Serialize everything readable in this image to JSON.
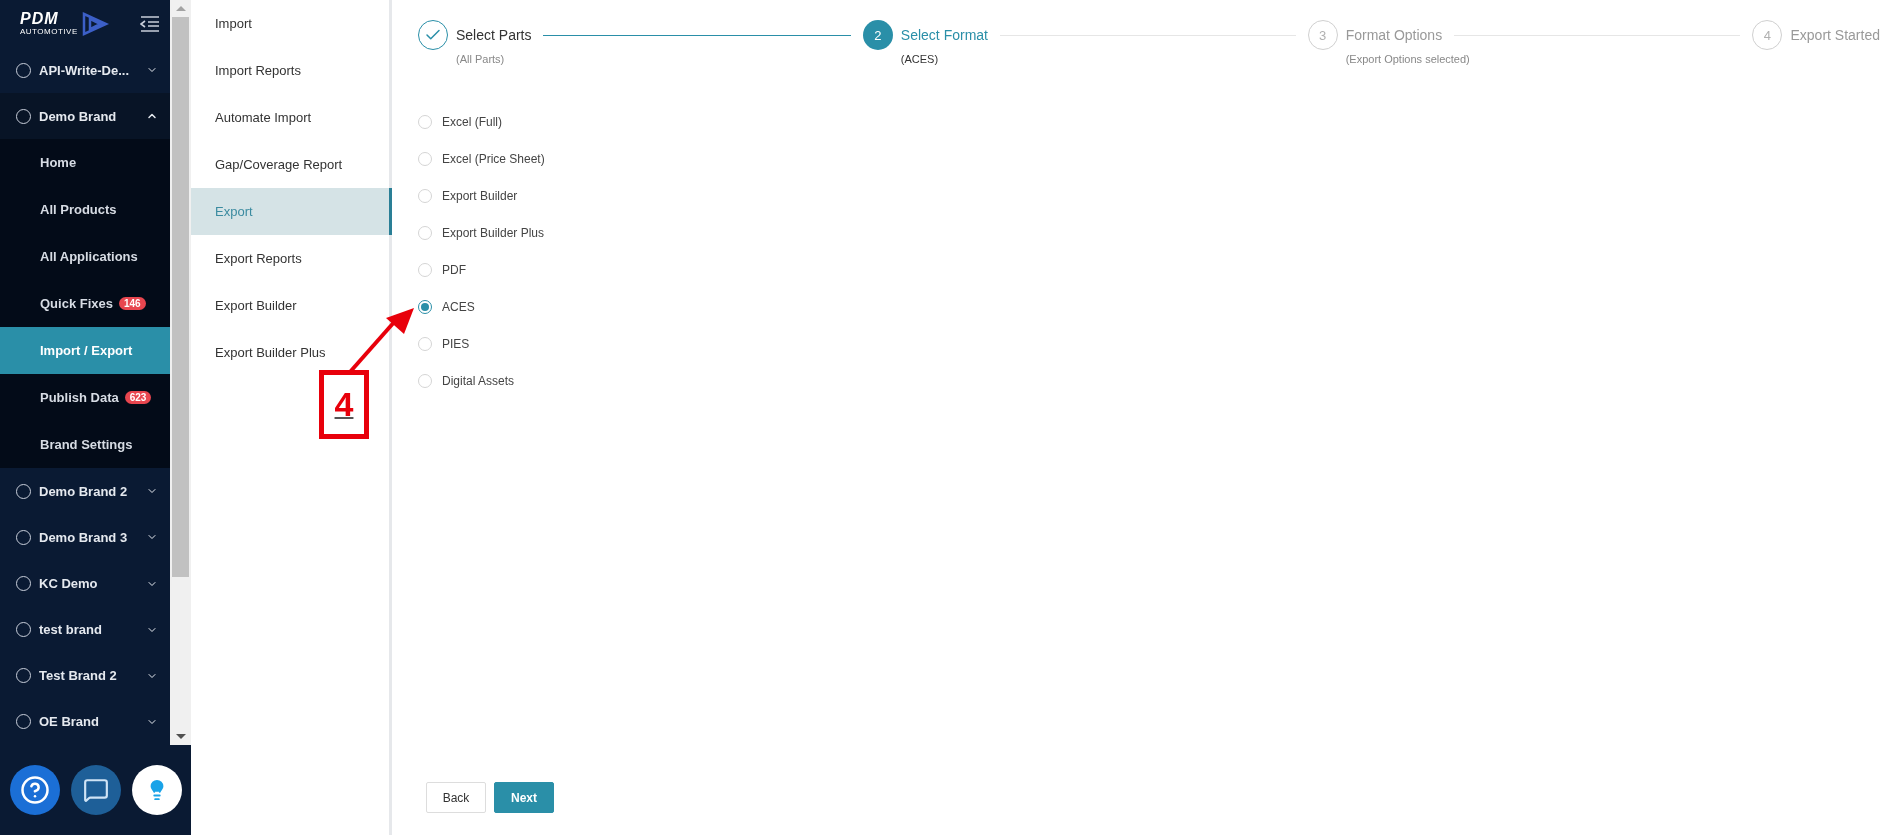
{
  "logo": {
    "name": "PDM",
    "tagline": "AUTOMOTIVE"
  },
  "sidebar": {
    "items": [
      {
        "label": "API-Write-De...",
        "expanded": false
      },
      {
        "label": "Demo Brand",
        "expanded": true,
        "children": [
          {
            "label": "Home",
            "selected": false
          },
          {
            "label": "All Products",
            "selected": false
          },
          {
            "label": "All Applications",
            "selected": false
          },
          {
            "label": "Quick Fixes",
            "badge": "146",
            "selected": false
          },
          {
            "label": "Import / Export",
            "selected": true
          },
          {
            "label": "Publish Data",
            "badge": "623",
            "selected": false
          },
          {
            "label": "Brand Settings",
            "selected": false
          }
        ]
      },
      {
        "label": "Demo Brand 2",
        "expanded": false
      },
      {
        "label": "Demo Brand 3",
        "expanded": false
      },
      {
        "label": "KC Demo",
        "expanded": false
      },
      {
        "label": "test brand",
        "expanded": false
      },
      {
        "label": "Test Brand 2",
        "expanded": false
      },
      {
        "label": "OE Brand",
        "expanded": false
      }
    ]
  },
  "subnav": {
    "items": [
      {
        "label": "Import",
        "selected": false
      },
      {
        "label": "Import Reports",
        "selected": false
      },
      {
        "label": "Automate Import",
        "selected": false
      },
      {
        "label": "Gap/Coverage Report",
        "selected": false
      },
      {
        "label": "Export",
        "selected": true
      },
      {
        "label": "Export Reports",
        "selected": false
      },
      {
        "label": "Export Builder",
        "selected": false
      },
      {
        "label": "Export Builder Plus",
        "selected": false
      }
    ]
  },
  "steps": [
    {
      "kind": "done",
      "title": "Select Parts",
      "subtitle": "(All Parts)"
    },
    {
      "kind": "active",
      "number": "2",
      "title": "Select Format",
      "subtitle": "(ACES)"
    },
    {
      "kind": "pending",
      "number": "3",
      "title": "Format Options",
      "subtitle": "(Export Options selected)"
    },
    {
      "kind": "pending",
      "number": "4",
      "title": "Export Started"
    }
  ],
  "formats": [
    {
      "label": "Excel (Full)",
      "selected": false
    },
    {
      "label": "Excel (Price Sheet)",
      "selected": false
    },
    {
      "label": "Export Builder",
      "selected": false
    },
    {
      "label": "Export Builder Plus",
      "selected": false
    },
    {
      "label": "PDF",
      "selected": false
    },
    {
      "label": "ACES",
      "selected": true
    },
    {
      "label": "PIES",
      "selected": false
    },
    {
      "label": "Digital Assets",
      "selected": false
    }
  ],
  "buttons": [
    "Back",
    "Next"
  ],
  "annotation": {
    "label": "4"
  }
}
